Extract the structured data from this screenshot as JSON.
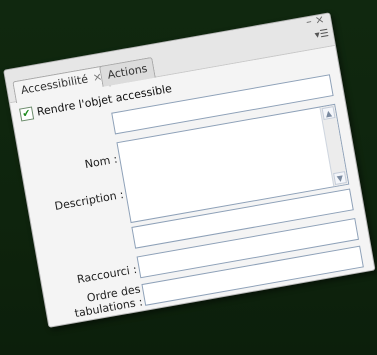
{
  "tabs": [
    {
      "label": "Accessibilité",
      "close": "×"
    },
    {
      "label": "Actions"
    }
  ],
  "window_controls": {
    "minimize": "–",
    "close": "×",
    "menu": "▾☰"
  },
  "checkbox": {
    "label": "Rendre l'objet accessible",
    "checked": true,
    "mark": "✔"
  },
  "fields": {
    "name_label": "Nom :",
    "description_label": "Description :",
    "shortcut_label": "Raccourci :",
    "tab_order_label_line1": "Ordre des",
    "tab_order_label_line2": "tabulations :"
  },
  "scroll": {
    "up": "▲",
    "down": "▼"
  }
}
